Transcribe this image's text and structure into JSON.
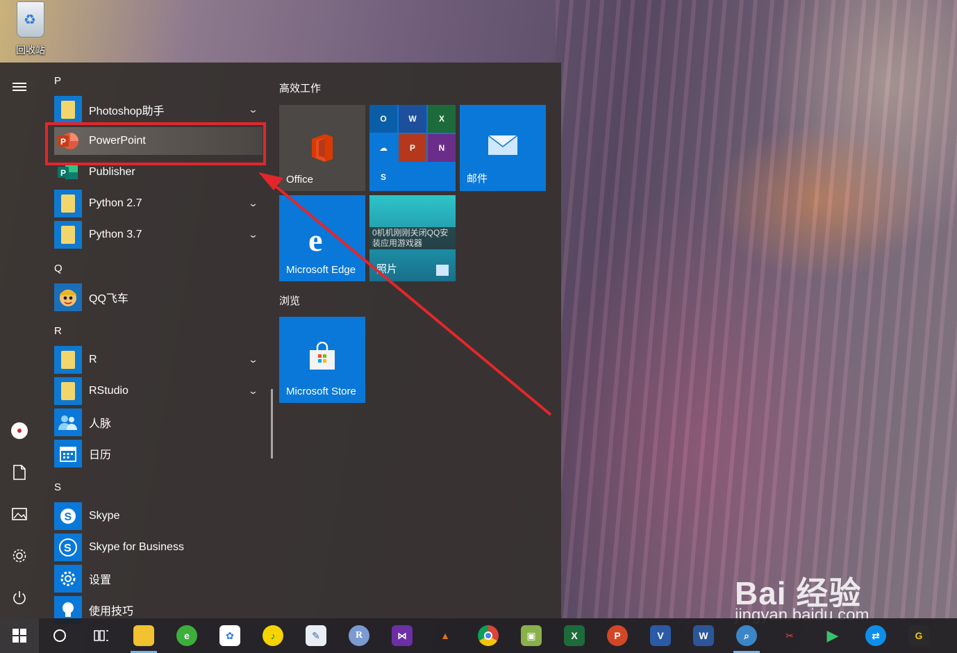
{
  "desktop": {
    "recycle_bin_label": "回收站"
  },
  "start_menu": {
    "rail": {
      "menu": "hamburger-icon",
      "user": "user-avatar-icon",
      "documents": "document-icon",
      "pictures": "pictures-icon",
      "settings": "gear-icon",
      "power": "power-icon"
    },
    "letters": {
      "p": "P",
      "q": "Q",
      "r": "R",
      "s": "S"
    },
    "apps": {
      "photoshop": "Photoshop助手",
      "powerpoint": "PowerPoint",
      "publisher": "Publisher",
      "python27": "Python 2.7",
      "python37": "Python 3.7",
      "qqfeiche": "QQ飞车",
      "r": "R",
      "rstudio": "RStudio",
      "renmai": "人脉",
      "rili": "日历",
      "skype": "Skype",
      "skype_business": "Skype for Business",
      "shezhi": "设置",
      "shiyong": "使用技巧"
    },
    "tiles": {
      "group1_title": "高效工作",
      "office": "Office",
      "mail": "邮件",
      "edge": "Microsoft Edge",
      "photos": "照片",
      "photos_overlay": "0机机刚刚关闭QQ安 装应用游戏器",
      "group2_title": "浏览",
      "store": "Microsoft Store"
    }
  },
  "taskbar": {
    "items": [
      "search-circle-icon",
      "task-view-icon",
      "file-explorer-icon",
      "ie-browser-icon",
      "baidu-netdisk-icon",
      "qq-music-icon",
      "notepad-icon",
      "r-icon",
      "visual-studio-icon",
      "matlab-icon",
      "chrome-icon",
      "image-viewer-icon",
      "excel-icon",
      "powerpoint-icon",
      "visio-icon",
      "word-icon",
      "magnifier-icon",
      "snipping-icon",
      "media-player-icon",
      "teamviewer-icon",
      "grammarly-icon"
    ]
  },
  "watermark": {
    "brand": "Bai 经验",
    "url": "jingyan.baidu.com"
  },
  "colors": {
    "accent": "#0a78d8",
    "highlight": "#e3262c",
    "menu_bg": "#363230"
  }
}
